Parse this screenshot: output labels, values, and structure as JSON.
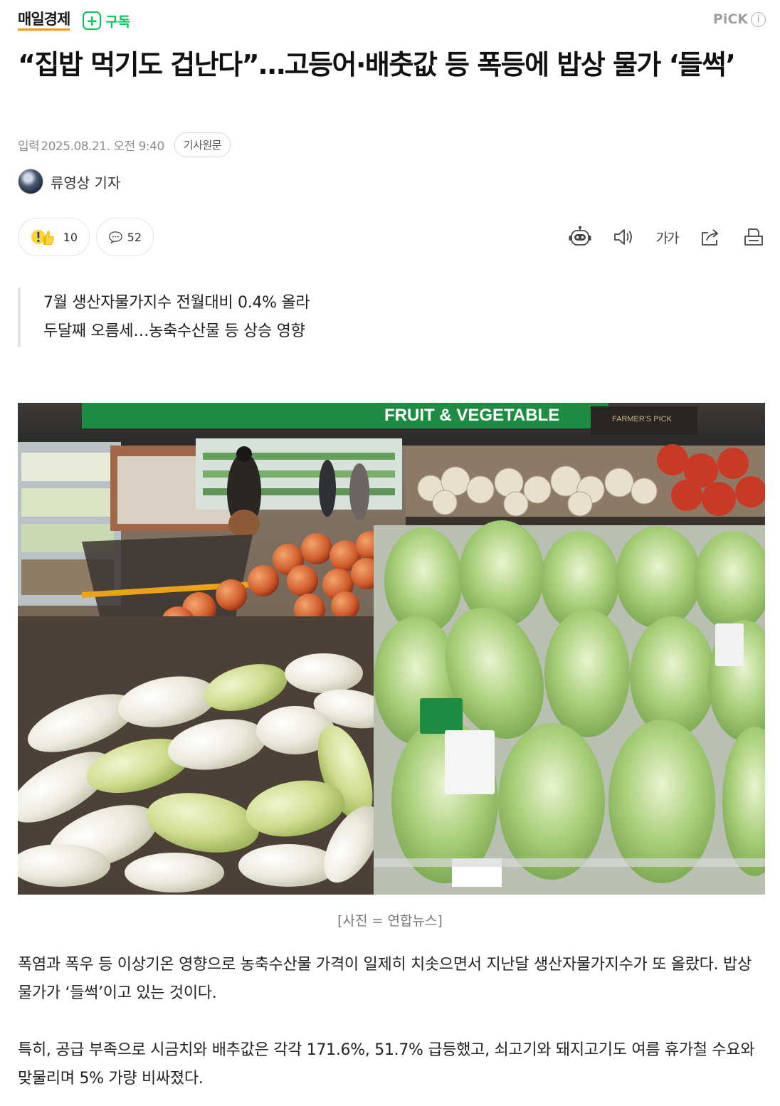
{
  "header": {
    "press_name": "매일경제",
    "subscribe_label": "구독",
    "pick_label": "PiCK",
    "info_glyph": "i"
  },
  "article": {
    "title": "“집밥 먹기도 겁난다”…고등어·배춧값 등 폭등에 밥상 물가 ‘들썩’",
    "date_label": "입력",
    "date": "2025.08.21. 오전 9:40",
    "original_link_label": "기사원문",
    "reporter": "류영상 기자",
    "reaction_count": "10",
    "comment_count": "52",
    "font_size_label": "가가",
    "summary": [
      "7월 생산자물가지수 전월대비 0.4% 올라",
      "두달째 오름세…농축수산물 등 상승 영향"
    ],
    "photo": {
      "sign_text": "FRUIT & VEGETABLE",
      "sign_sub": "FARMER'S PICK",
      "caption": "[사진 = 연합뉴스]"
    },
    "paragraphs": [
      "폭염과 폭우 등 이상기온 영향으로 농축수산물 가격이 일제히 치솟으면서 지난달 생산자물가지수가 또 올랐다. 밥상 물가가 ‘들썩’이고 있는 것이다.",
      "특히, 공급 부족으로 시금치와 배추값은 각각 171.6%, 51.7% 급등했고, 쇠고기와 돼지고기도 여름 휴가철 수요와 맞물리며 5% 가량 비싸졌다."
    ]
  },
  "colors": {
    "accent_green": "#03c75a",
    "logo_underline": "#f39800"
  },
  "icons": [
    "plus-icon",
    "info-icon",
    "reaction-icon",
    "comment-icon",
    "ai-summary-icon",
    "speaker-icon",
    "font-size-icon",
    "share-icon",
    "print-icon"
  ]
}
